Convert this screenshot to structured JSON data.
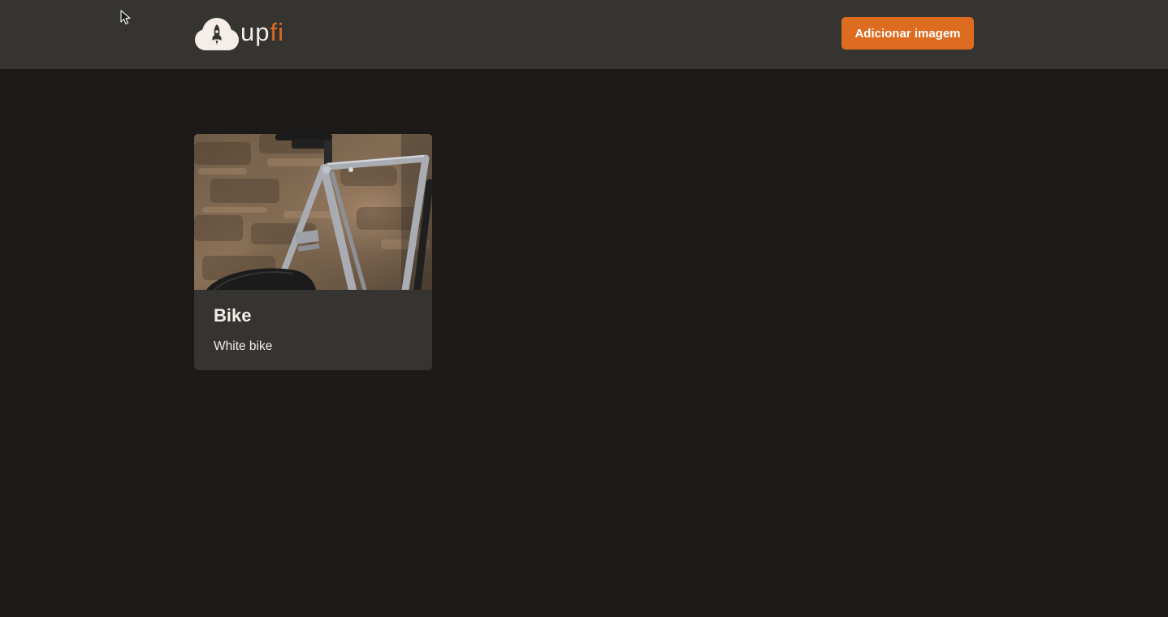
{
  "header": {
    "logo": {
      "text_part1": "up",
      "text_part2": "fi",
      "icon": "cloud-rocket-icon",
      "accent_color": "#dd6b20"
    },
    "add_button_label": "Adicionar imagem"
  },
  "cards": [
    {
      "title": "Bike",
      "description": "White bike",
      "image": "bike-photo"
    }
  ],
  "colors": {
    "background": "#1b1a19",
    "header": "#353431",
    "card": "#353431",
    "accent": "#dd6b20",
    "text": "#f4ede8"
  }
}
